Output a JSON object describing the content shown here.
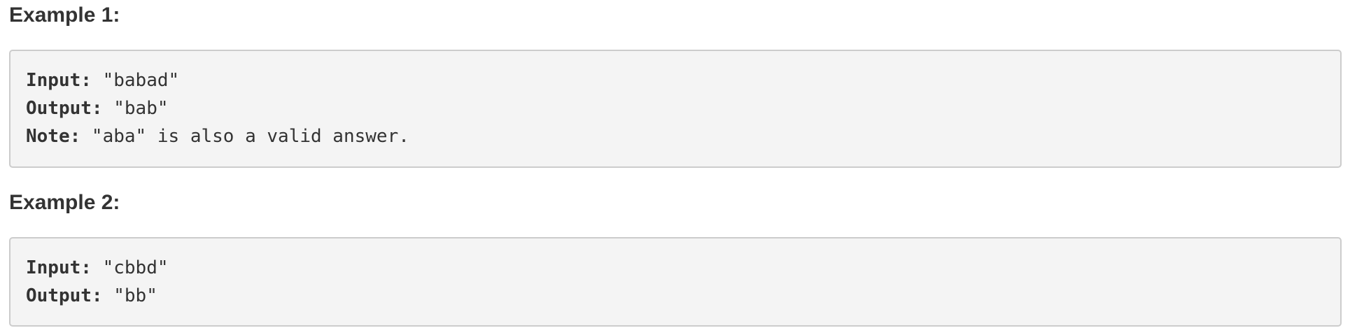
{
  "examples": [
    {
      "heading": "Example 1:",
      "lines": [
        {
          "key": "Input:",
          "value": " \"babad\""
        },
        {
          "key": "Output:",
          "value": " \"bab\""
        },
        {
          "key": "Note:",
          "value": " \"aba\" is also a valid answer."
        }
      ]
    },
    {
      "heading": "Example 2:",
      "lines": [
        {
          "key": "Input:",
          "value": " \"cbbd\""
        },
        {
          "key": "Output:",
          "value": " \"bb\""
        }
      ]
    }
  ]
}
